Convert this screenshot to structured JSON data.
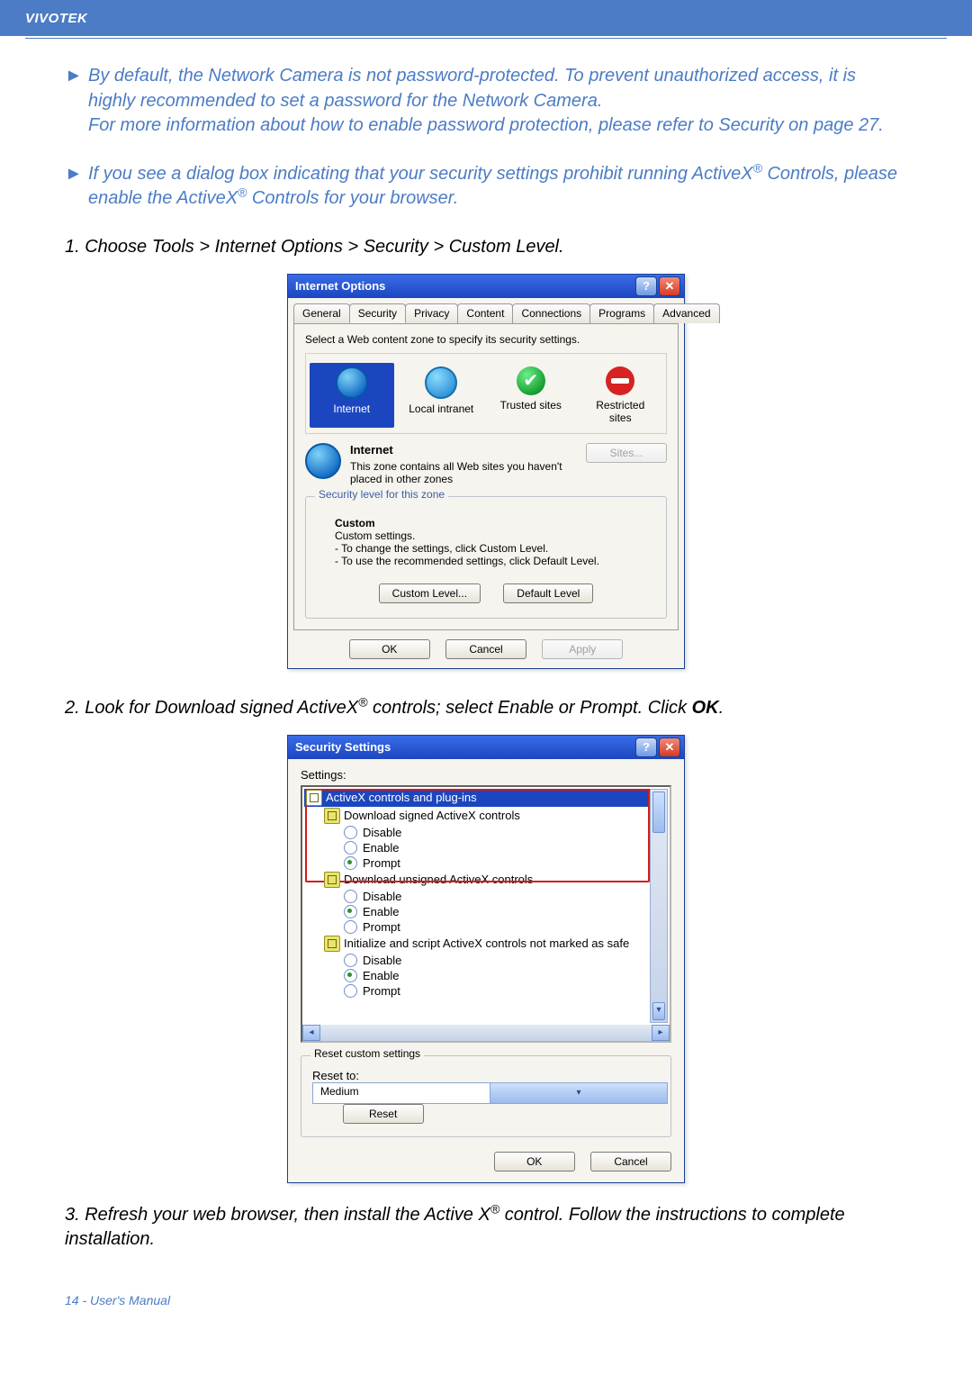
{
  "header": {
    "brand": "VIVOTEK"
  },
  "notes": [
    {
      "bullet": "►",
      "html": "By default, the Network Camera is not password-protected. To prevent unauthorized access, it is highly recommended to set a password for the Network Camera.<br>For more information about how to enable password protection, please refer to Security on page 27."
    },
    {
      "bullet": "►",
      "html": "If you see a dialog box indicating that your security settings prohibit running ActiveX<sup>®</sup> Controls, please enable the ActiveX<sup>®</sup> Controls for your browser."
    }
  ],
  "step1": "1. Choose Tools > Internet Options > Security > Custom Level.",
  "step2_html": "2. Look for Download signed ActiveX<sup>®</sup> controls; select Enable or Prompt. Click <b>OK</b>.",
  "step3_html": "3. Refresh your web browser, then install the Active X<sup>®</sup> control. Follow the instructions to complete installation.",
  "internet_options": {
    "title": "Internet Options",
    "tabs": [
      "General",
      "Security",
      "Privacy",
      "Content",
      "Connections",
      "Programs",
      "Advanced"
    ],
    "active_tab": "Security",
    "select_text": "Select a Web content zone to specify its security settings.",
    "zones": [
      {
        "name": "Internet",
        "icon": "globe",
        "selected": true
      },
      {
        "name": "Local intranet",
        "icon": "local",
        "selected": false
      },
      {
        "name": "Trusted sites",
        "icon": "check",
        "selected": false
      },
      {
        "name": "Restricted\nsites",
        "icon": "stop",
        "selected": false
      }
    ],
    "zone_heading": "Internet",
    "zone_desc": "This zone contains all Web sites you haven't placed in other zones",
    "sites_button": "Sites...",
    "group_title": "Security level for this zone",
    "custom_label": "Custom",
    "custom_sub": "Custom settings.",
    "custom_line1": "- To change the settings, click Custom Level.",
    "custom_line2": "- To use the recommended settings, click Default Level.",
    "custom_level_btn": "Custom Level...",
    "default_level_btn": "Default Level",
    "ok_btn": "OK",
    "cancel_btn": "Cancel",
    "apply_btn": "Apply"
  },
  "security_settings": {
    "title": "Security Settings",
    "settings_label": "Settings:",
    "items": [
      {
        "type": "group",
        "label": "ActiveX controls and plug-ins",
        "selected": true,
        "icon": true,
        "indent": 0
      },
      {
        "type": "group",
        "label": "Download signed ActiveX controls",
        "icon": true,
        "indent": 1
      },
      {
        "type": "option",
        "label": "Disable",
        "checked": false,
        "indent": 2
      },
      {
        "type": "option",
        "label": "Enable",
        "checked": false,
        "indent": 2
      },
      {
        "type": "option",
        "label": "Prompt",
        "checked": true,
        "indent": 2
      },
      {
        "type": "group",
        "label": "Download unsigned ActiveX controls",
        "icon": true,
        "indent": 1
      },
      {
        "type": "option",
        "label": "Disable",
        "checked": false,
        "indent": 2
      },
      {
        "type": "option",
        "label": "Enable",
        "checked": true,
        "indent": 2
      },
      {
        "type": "option",
        "label": "Prompt",
        "checked": false,
        "indent": 2
      },
      {
        "type": "group",
        "label": "Initialize and script ActiveX controls not marked as safe",
        "icon": true,
        "indent": 1
      },
      {
        "type": "option",
        "label": "Disable",
        "checked": false,
        "indent": 2
      },
      {
        "type": "option",
        "label": "Enable",
        "checked": true,
        "indent": 2
      },
      {
        "type": "option",
        "label": "Prompt",
        "checked": false,
        "indent": 2
      }
    ],
    "reset_group": "Reset custom settings",
    "reset_to_label": "Reset to:",
    "reset_value": "Medium",
    "reset_btn": "Reset",
    "ok_btn": "OK",
    "cancel_btn": "Cancel"
  },
  "page_footer": "14 - User's Manual"
}
